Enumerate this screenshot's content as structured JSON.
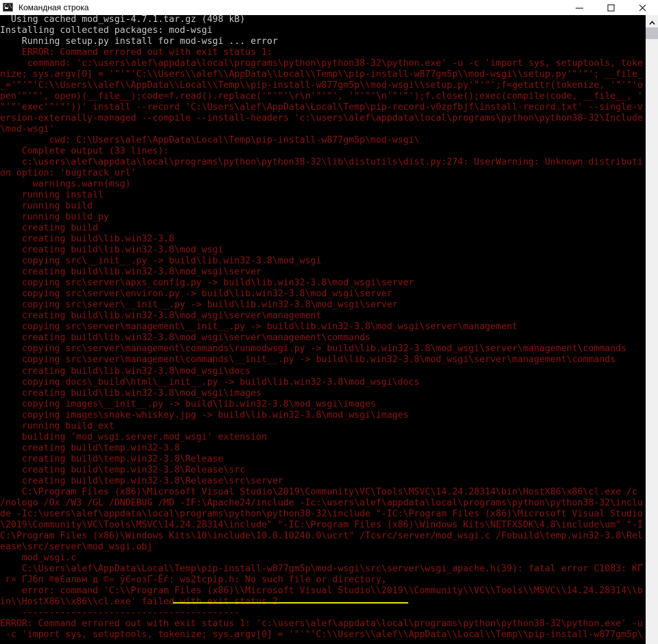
{
  "window": {
    "title": "Командная строка",
    "icon": "cmd-console-icon",
    "controls": {
      "minimize_label": "—",
      "maximize_label": "☐",
      "close_label": "✕"
    }
  },
  "theme": {
    "background": "#000000",
    "normal_text": "#c8c8c8",
    "error_text": "#8b1212",
    "annotation": "#e8e000",
    "titlebar_bg": "#ffffff",
    "scrollbar_track": "#f0f0f0",
    "scrollbar_thumb": "#c2c3c9"
  },
  "scrollbar": {
    "up_arrow": "▲",
    "position_percent": 2
  },
  "annotations": [
    {
      "name": "ws2tcpip-underline",
      "color": "#e8e000",
      "target_text": "ws2tcpip.h: No such file or directory,"
    }
  ],
  "console": {
    "lines": [
      {
        "text": "  Using cached mod_wsgi-4.7.1.tar.gz (498 kB)",
        "color": "white"
      },
      {
        "text": "Installing collected packages: mod-wsgi",
        "color": "white"
      },
      {
        "text": "    Running setup.py install for mod-wsgi ... error",
        "color": "white"
      },
      {
        "text": "    ERROR: Command errored out with exit status 1:",
        "color": "red"
      },
      {
        "text": "     command: 'c:\\users\\alef\\appdata\\local\\programs\\python\\python38-32\\python.exe' -u -c 'import sys, setuptools, toke",
        "color": "red"
      },
      {
        "text": "nize; sys.argv[0] = '\"'\"'C:\\\\Users\\\\alef\\\\AppData\\\\Local\\\\Temp\\\\pip-install-w877gm5p\\\\mod-wsgi\\\\setup.py'\"'\"'; __file_",
        "color": "red"
      },
      {
        "text": "_='\"'\"'C:\\\\Users\\\\alef\\\\AppData\\\\Local\\\\Temp\\\\pip-install-w877gm5p\\\\mod-wsgi\\\\setup.py'\"'\"';f=getattr(tokenize, '\"'\"'o",
        "color": "red"
      },
      {
        "text": "pen'\"'\"', open)(__file__);code=f.read().replace('\"'\"'\\r\\n'\"'\"', '\"'\"'\\n'\"'\"');f.close();exec(compile(code, __file__, '",
        "color": "red"
      },
      {
        "text": "\"'\"'exec'\"'\"'))' install --record 'C:\\Users\\alef\\AppData\\Local\\Temp\\pip-record-v0zpfbjf\\install-record.txt' --single-v",
        "color": "red"
      },
      {
        "text": "ersion-externally-managed --compile --install-headers 'c:\\users\\alef\\appdata\\local\\programs\\python\\python38-32\\Include",
        "color": "red"
      },
      {
        "text": "\\mod-wsgi'",
        "color": "red"
      },
      {
        "text": "         cwd: C:\\Users\\alef\\AppData\\Local\\Temp\\pip-install-w877gm5p\\mod-wsgi\\",
        "color": "red"
      },
      {
        "text": "    Complete output (33 lines):",
        "color": "red"
      },
      {
        "text": "    c:\\users\\alef\\appdata\\local\\programs\\python\\python38-32\\lib\\distutils\\dist.py:274: UserWarning: Unknown distributi",
        "color": "red"
      },
      {
        "text": "on option: 'bugtrack_url'",
        "color": "red"
      },
      {
        "text": "      warnings.warn(msg)",
        "color": "red"
      },
      {
        "text": "    running install",
        "color": "red"
      },
      {
        "text": "    running build",
        "color": "red"
      },
      {
        "text": "    running build_py",
        "color": "red"
      },
      {
        "text": "    creating build",
        "color": "red"
      },
      {
        "text": "    creating build\\lib.win32-3.8",
        "color": "red"
      },
      {
        "text": "    creating build\\lib.win32-3.8\\mod_wsgi",
        "color": "red"
      },
      {
        "text": "    copying src\\__init__.py -> build\\lib.win32-3.8\\mod_wsgi",
        "color": "red"
      },
      {
        "text": "    creating build\\lib.win32-3.8\\mod_wsgi\\server",
        "color": "red"
      },
      {
        "text": "    copying src\\server\\apxs_config.py -> build\\lib.win32-3.8\\mod_wsgi\\server",
        "color": "red"
      },
      {
        "text": "    copying src\\server\\environ.py -> build\\lib.win32-3.8\\mod_wsgi\\server",
        "color": "red"
      },
      {
        "text": "    copying src\\server\\__init__.py -> build\\lib.win32-3.8\\mod_wsgi\\server",
        "color": "red"
      },
      {
        "text": "    creating build\\lib.win32-3.8\\mod_wsgi\\server\\management",
        "color": "red"
      },
      {
        "text": "    copying src\\server\\management\\__init__.py -> build\\lib.win32-3.8\\mod_wsgi\\server\\management",
        "color": "red"
      },
      {
        "text": "    creating build\\lib.win32-3.8\\mod_wsgi\\server\\management\\commands",
        "color": "red"
      },
      {
        "text": "    copying src\\server\\management\\commands\\runmodwsgi.py -> build\\lib.win32-3.8\\mod_wsgi\\server\\management\\commands",
        "color": "red"
      },
      {
        "text": "    copying src\\server\\management\\commands\\__init__.py -> build\\lib.win32-3.8\\mod_wsgi\\server\\management\\commands",
        "color": "red"
      },
      {
        "text": "    creating build\\lib.win32-3.8\\mod_wsgi\\docs",
        "color": "red"
      },
      {
        "text": "    copying docs\\_build\\html\\__init__.py -> build\\lib.win32-3.8\\mod_wsgi\\docs",
        "color": "red"
      },
      {
        "text": "    creating build\\lib.win32-3.8\\mod_wsgi\\images",
        "color": "red"
      },
      {
        "text": "    copying images\\__init__.py -> build\\lib.win32-3.8\\mod_wsgi\\images",
        "color": "red"
      },
      {
        "text": "    copying images\\snake-whiskey.jpg -> build\\lib.win32-3.8\\mod_wsgi\\images",
        "color": "red"
      },
      {
        "text": "    running build_ext",
        "color": "red"
      },
      {
        "text": "    building 'mod_wsgi.server.mod_wsgi' extension",
        "color": "red"
      },
      {
        "text": "    creating build\\temp.win32-3.8",
        "color": "red"
      },
      {
        "text": "    creating build\\temp.win32-3.8\\Release",
        "color": "red"
      },
      {
        "text": "    creating build\\temp.win32-3.8\\Release\\src",
        "color": "red"
      },
      {
        "text": "    creating build\\temp.win32-3.8\\Release\\src\\server",
        "color": "red"
      },
      {
        "text": "    C:\\Program Files (x86)\\Microsoft Visual Studio\\2019\\Community\\VC\\Tools\\MSVC\\14.24.28314\\bin\\HostX86\\x86\\cl.exe /c",
        "color": "red"
      },
      {
        "text": "/nologo /Ox /W3 /GL /DNDEBUG /MD -IF:\\Apache24/include -Ic:\\users\\alef\\appdata\\local\\programs\\python\\python38-32\\inclu",
        "color": "red"
      },
      {
        "text": "de -Ic:\\users\\alef\\appdata\\local\\programs\\python\\python38-32\\include \"-IC:\\Program Files (x86)\\Microsoft Visual Studio",
        "color": "red"
      },
      {
        "text": "\\2019\\Community\\VC\\Tools\\MSVC\\14.24.28314\\include\" \"-IC:\\Program Files (x86)\\Windows Kits\\NETFXSDK\\4.8\\include\\um\" \"-I",
        "color": "red"
      },
      {
        "text": "C:\\Program Files (x86)\\Windows Kits\\10\\include\\10.0.10240.0\\ucrt\" /Tcsrc/server/mod_wsgi.c /Fobuild\\temp.win32-3.8\\Rel",
        "color": "red"
      },
      {
        "text": "ease\\src/server\\mod_wsgi.obj",
        "color": "red"
      },
      {
        "text": "    mod_wsgi.c",
        "color": "red"
      },
      {
        "text": "    C:\\Users\\alef\\AppData\\Local\\Temp\\pip-install-w877gm5p\\mod-wsgi\\src\\server\\wsgi_apache.h(39): fatal error C1083: ЌҐ",
        "color": "red"
      },
      {
        "text": " г¤ ҐЈбп ®вЄалвм д ©« ўЄ«озҐ-Ёѓ: ws2tcpip.h: No such file or directory,",
        "color": "red"
      },
      {
        "text": "    error: command 'C:\\\\Program Files (x86)\\\\Microsoft Visual Studio\\\\2019\\\\Community\\\\VC\\\\Tools\\\\MSVC\\\\14.24.28314\\\\b",
        "color": "red"
      },
      {
        "text": "in\\\\HostX86\\\\x86\\\\cl.exe' failed with exit status 2",
        "color": "red"
      },
      {
        "text": "    ----------------------------------------",
        "color": "red"
      },
      {
        "text": "ERROR: Command errored out with exit status 1: 'c:\\users\\alef\\appdata\\local\\programs\\python\\python38-32\\python.exe' -u",
        "color": "red"
      },
      {
        "text": " -c 'import sys, setuptools, tokenize; sys.argv[0] = '\"'\"'C:\\\\Users\\\\alef\\\\AppData\\\\Local\\\\Temp\\\\pip-install-w877gm5p\\",
        "color": "red"
      }
    ]
  }
}
